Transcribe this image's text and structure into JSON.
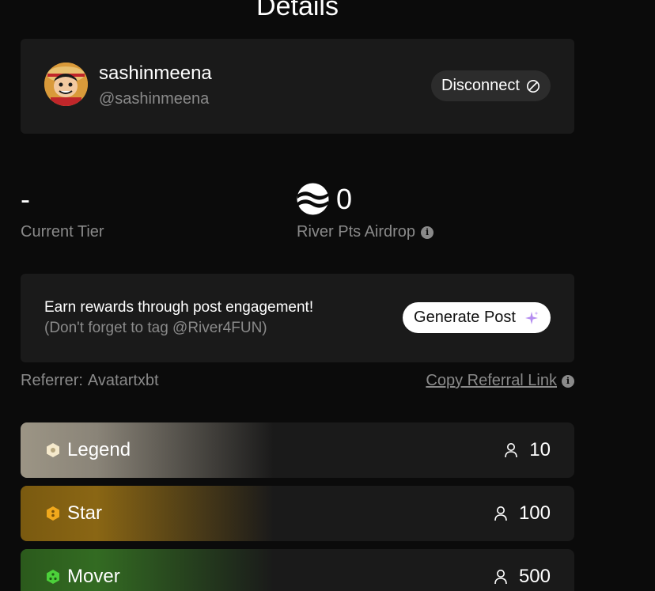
{
  "page": {
    "title": "Details"
  },
  "profile": {
    "username": "sashinmeena",
    "handle": "@sashinmeena",
    "disconnect_label": "Disconnect",
    "avatar_icon": "anime-character-avatar"
  },
  "stats": {
    "tier_value": "-",
    "tier_label": "Current Tier",
    "points_value": "0",
    "points_label": "River Pts Airdrop",
    "points_icon": "river-logo-icon"
  },
  "earn": {
    "line1": "Earn rewards through post engagement!",
    "line2": "(Don't forget to tag @River4FUN)",
    "button_label": "Generate Post",
    "button_icon": "sparkle-icon"
  },
  "referral": {
    "label": "Referrer:",
    "name": "Avatartxbt",
    "copy_label": "Copy Referral Link"
  },
  "tiers": [
    {
      "name": "Legend",
      "count": "10",
      "color": "#f5e9cc"
    },
    {
      "name": "Star",
      "count": "100",
      "color": "#f0a81c"
    },
    {
      "name": "Mover",
      "count": "500",
      "color": "#4cd13a"
    }
  ],
  "colors": {
    "background": "#0b0b0b",
    "card": "#1a1a1a",
    "muted_text": "#8a8a8a",
    "sparkle": "#b48cf0"
  }
}
